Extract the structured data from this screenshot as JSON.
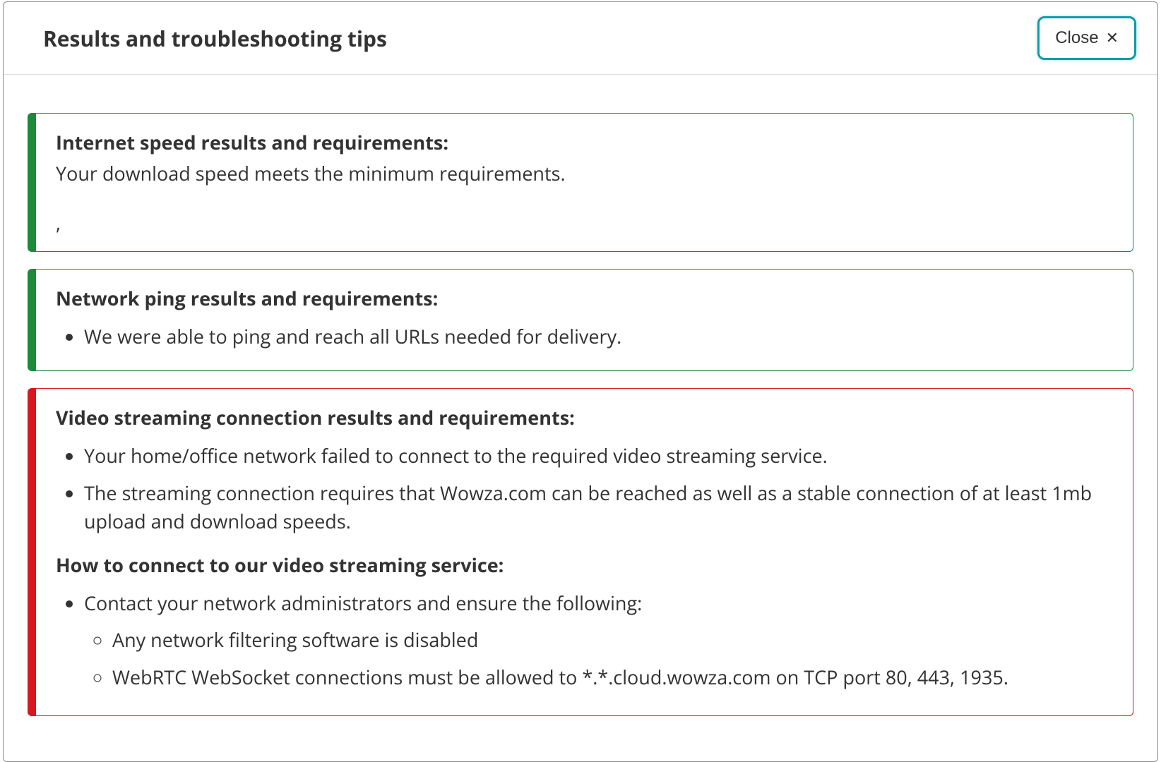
{
  "header": {
    "title": "Results and troubleshooting tips",
    "close_label": "Close"
  },
  "panels": {
    "speed": {
      "heading": "Internet speed results and requirements:",
      "body": "Your download speed meets the minimum requirements.",
      "stray": ","
    },
    "ping": {
      "heading": "Network ping results and requirements:",
      "item0": "We were able to ping and reach all URLs needed for delivery."
    },
    "video": {
      "heading": "Video streaming connection results and requirements:",
      "item0": "Your home/office network failed to connect to the required video streaming service.",
      "item1": "The streaming connection requires that Wowza.com can be reached as well as a stable connection of at least 1mb upload and download speeds.",
      "fix_heading": "How to connect to our video streaming service:",
      "fix0": "Contact your network administrators and ensure the following:",
      "fix0a": "Any network filtering software is disabled",
      "fix0b": "WebRTC WebSocket connections must be allowed to *.*.cloud.wowza.com on TCP port 80, 443, 1935."
    }
  }
}
